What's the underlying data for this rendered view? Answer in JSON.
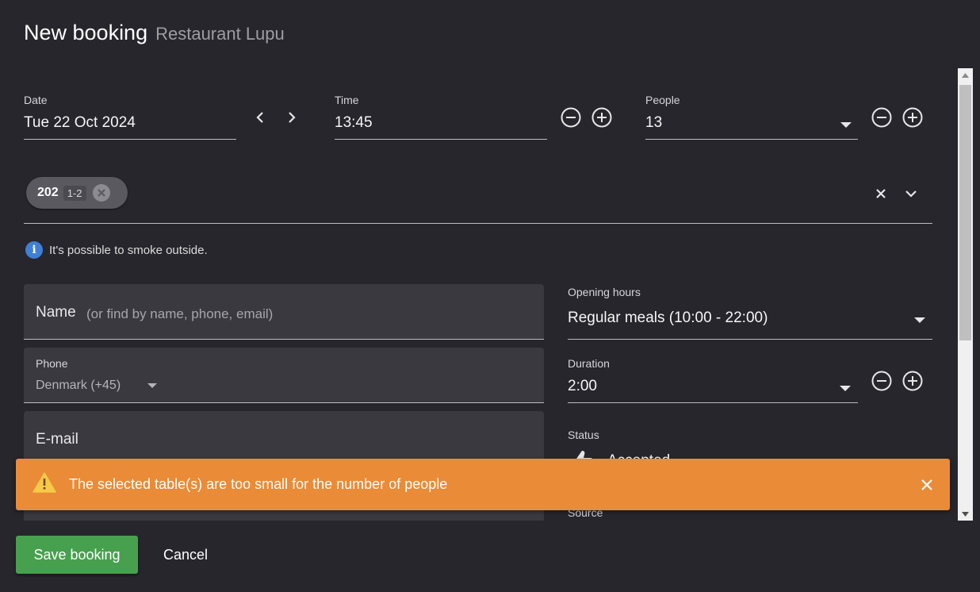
{
  "dialog": {
    "title": "New booking",
    "subtitle": "Restaurant Lupu"
  },
  "date": {
    "label": "Date",
    "value": "Tue 22 Oct 2024"
  },
  "time": {
    "label": "Time",
    "value": "13:45"
  },
  "people": {
    "label": "People",
    "value": "13"
  },
  "table_chip": {
    "label": "202",
    "capacity": "1-2"
  },
  "info": {
    "text": "It's possible to smoke outside."
  },
  "name_field": {
    "label": "Name",
    "placeholder": "(or find by name, phone, email)"
  },
  "phone_field": {
    "label": "Phone",
    "country": "Denmark (+45)"
  },
  "email_field": {
    "label": "E-mail"
  },
  "opening_hours": {
    "label": "Opening hours",
    "value": "Regular meals (10:00 - 22:00)"
  },
  "duration": {
    "label": "Duration",
    "value": "2:00"
  },
  "status": {
    "label": "Status",
    "value": "Accepted"
  },
  "source": {
    "label": "Source"
  },
  "toast": {
    "message": "The selected table(s) are too small for the number of people"
  },
  "actions": {
    "save_label": "Save booking",
    "cancel_label": "Cancel"
  },
  "colors": {
    "background": "#26262c",
    "warning": "#e98b37",
    "save": "#47a04d",
    "info": "#3f7fd6"
  }
}
